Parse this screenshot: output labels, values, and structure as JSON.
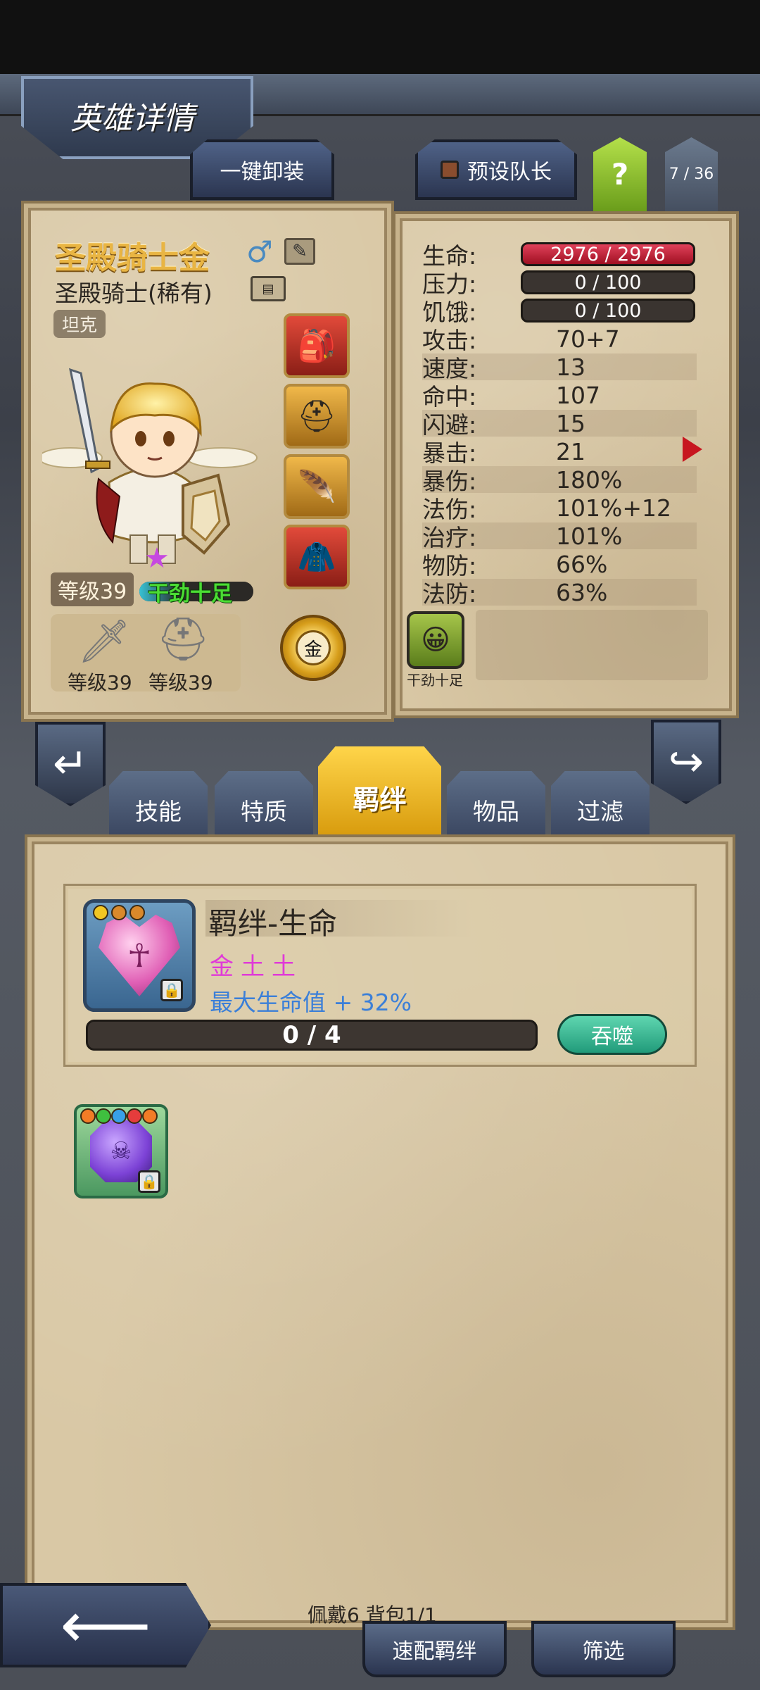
{
  "header": {
    "title": "英雄详情"
  },
  "top_tabs": {
    "unequip_all": "一键卸装",
    "preset_captain": "预设队长",
    "help": "?",
    "page_counter": "7 / 36"
  },
  "hero": {
    "name": "圣殿骑士金",
    "gender_icon": "male-icon",
    "class": "圣殿骑士(稀有)",
    "role": "坦克",
    "level": "等级39",
    "mood": "干劲十足",
    "weapon_level": "等级39",
    "helmet_level": "等级39",
    "element": "金",
    "equipment": [
      {
        "name": "backpack-equip-icon",
        "glyph": "🎒",
        "color": "#c6432c"
      },
      {
        "name": "helmet-equip-icon",
        "glyph": "⛑",
        "color": "#d89b3b"
      },
      {
        "name": "amulet-equip-icon",
        "glyph": "🪽",
        "color": "#d89b3b"
      },
      {
        "name": "armor-equip-icon",
        "glyph": "🧥",
        "color": "#c6432c"
      }
    ]
  },
  "stats": {
    "hp": {
      "label": "生命:",
      "value": "2976 / 2976"
    },
    "stress": {
      "label": "压力:",
      "value": "0 / 100"
    },
    "hunger": {
      "label": "饥饿:",
      "value": "0 / 100"
    },
    "rows": [
      {
        "label": "攻击:",
        "value": "70+7"
      },
      {
        "label": "速度:",
        "value": "13"
      },
      {
        "label": "命中:",
        "value": "107"
      },
      {
        "label": "闪避:",
        "value": "15"
      },
      {
        "label": "暴击:",
        "value": "21"
      },
      {
        "label": "暴伤:",
        "value": "180%"
      },
      {
        "label": "法伤:",
        "value": "101%+12"
      },
      {
        "label": "治疗:",
        "value": "101%"
      },
      {
        "label": "物防:",
        "value": "66%"
      },
      {
        "label": "法防:",
        "value": "63%"
      }
    ],
    "trait_label": "干劲十足"
  },
  "category_tabs": {
    "skills": "技能",
    "traits": "特质",
    "bonds": "羁绊",
    "items": "物品",
    "filter": "过滤"
  },
  "bond": {
    "title": "羁绊-生命",
    "elements": "金土土",
    "effect": "最大生命值 + 32%",
    "progress": "0 / 4",
    "progress_fraction": 0,
    "devour_label": "吞噬",
    "dot_colors": [
      "#f2c623",
      "#d9892b",
      "#d9892b"
    ]
  },
  "gem": {
    "dot_colors": [
      "#f27c26",
      "#3fbf3f",
      "#38a0e8",
      "#e63c3c",
      "#f27c26"
    ]
  },
  "footer": {
    "status": "佩戴6 背包1/1",
    "quick_match": "速配羁绊",
    "filter": "筛选"
  }
}
